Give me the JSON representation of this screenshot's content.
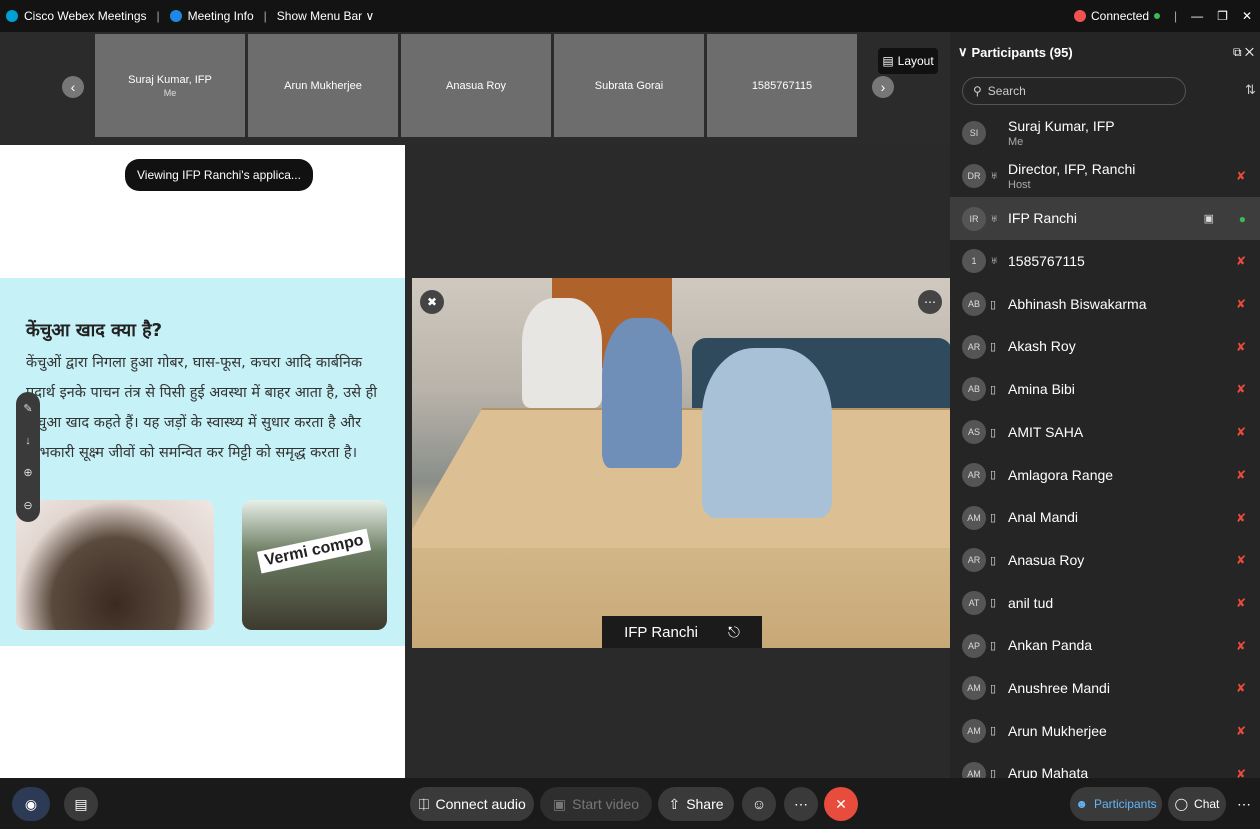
{
  "titlebar": {
    "app_name": "Cisco Webex Meetings",
    "meeting_info": "Meeting Info",
    "menu_bar": "Show Menu Bar ∨",
    "status": "Connected"
  },
  "filmstrip": {
    "thumbs": [
      {
        "name": "Suraj Kumar, IFP",
        "sub": "Me"
      },
      {
        "name": "Arun Mukherjee",
        "sub": ""
      },
      {
        "name": "Anasua Roy",
        "sub": ""
      },
      {
        "name": "Subrata Gorai",
        "sub": ""
      },
      {
        "name": "1585767115",
        "sub": ""
      }
    ],
    "layout_label": "Layout"
  },
  "share": {
    "viewing_label": "Viewing IFP Ranchi's applica...",
    "slide_title": "केंचुआ खाद क्या है?",
    "slide_body": "केंचुओं द्वारा निगला हुआ गोबर, घास-फूस, कचरा आदि कार्बनिक पदार्थ इनके पाचन तंत्र से पिसी हुई अवस्था में बाहर आता है, उसे ही केंचुआ खाद कहते हैं। यह जड़ों के स्वास्थ्य में सुधार करता है और लाभकारी सूक्ष्म जीवों को समन्वित कर मिट्टी को समृद्ध करता है।",
    "image2_text": "Vermi compo"
  },
  "video": {
    "label": "IFP Ranchi"
  },
  "panel": {
    "title": "Participants (95)",
    "search_placeholder": "Search",
    "participants": [
      {
        "initials": "SI",
        "name": "Suraj Kumar, IFP",
        "sub": "Me",
        "icon": "",
        "state": "none"
      },
      {
        "initials": "DR",
        "name": "Director, IFP, Ranchi",
        "sub": "Host",
        "icon": "headset",
        "state": "muted"
      },
      {
        "initials": "IR",
        "name": "IFP Ranchi",
        "sub": "",
        "icon": "headset",
        "state": "active"
      },
      {
        "initials": "1",
        "name": "1585767115",
        "sub": "",
        "icon": "headset",
        "state": "muted"
      },
      {
        "initials": "AB",
        "name": "Abhinash Biswakarma",
        "sub": "",
        "icon": "device",
        "state": "muted"
      },
      {
        "initials": "AR",
        "name": "Akash Roy",
        "sub": "",
        "icon": "device",
        "state": "muted"
      },
      {
        "initials": "AB",
        "name": "Amina Bibi",
        "sub": "",
        "icon": "device",
        "state": "muted"
      },
      {
        "initials": "AS",
        "name": "AMIT SAHA",
        "sub": "",
        "icon": "device",
        "state": "muted"
      },
      {
        "initials": "AR",
        "name": "Amlagora Range",
        "sub": "",
        "icon": "device",
        "state": "muted"
      },
      {
        "initials": "AM",
        "name": "Anal Mandi",
        "sub": "",
        "icon": "device",
        "state": "muted"
      },
      {
        "initials": "AR",
        "name": "Anasua Roy",
        "sub": "",
        "icon": "device",
        "state": "muted"
      },
      {
        "initials": "AT",
        "name": "anil tud",
        "sub": "",
        "icon": "device",
        "state": "muted"
      },
      {
        "initials": "AP",
        "name": "Ankan Panda",
        "sub": "",
        "icon": "device",
        "state": "muted"
      },
      {
        "initials": "AM",
        "name": "Anushree Mandi",
        "sub": "",
        "icon": "device",
        "state": "muted"
      },
      {
        "initials": "AM",
        "name": "Arun Mukherjee",
        "sub": "",
        "icon": "device",
        "state": "muted"
      },
      {
        "initials": "AM",
        "name": "Arup Mahata",
        "sub": "",
        "icon": "device",
        "state": "muted"
      }
    ]
  },
  "bottombar": {
    "connect_audio": "Connect audio",
    "start_video": "Start video",
    "share": "Share",
    "participants": "Participants",
    "chat": "Chat"
  },
  "colors": {
    "end_call": "#e74c3c",
    "muted": "#e74c3c",
    "connected": "#3cba54"
  }
}
